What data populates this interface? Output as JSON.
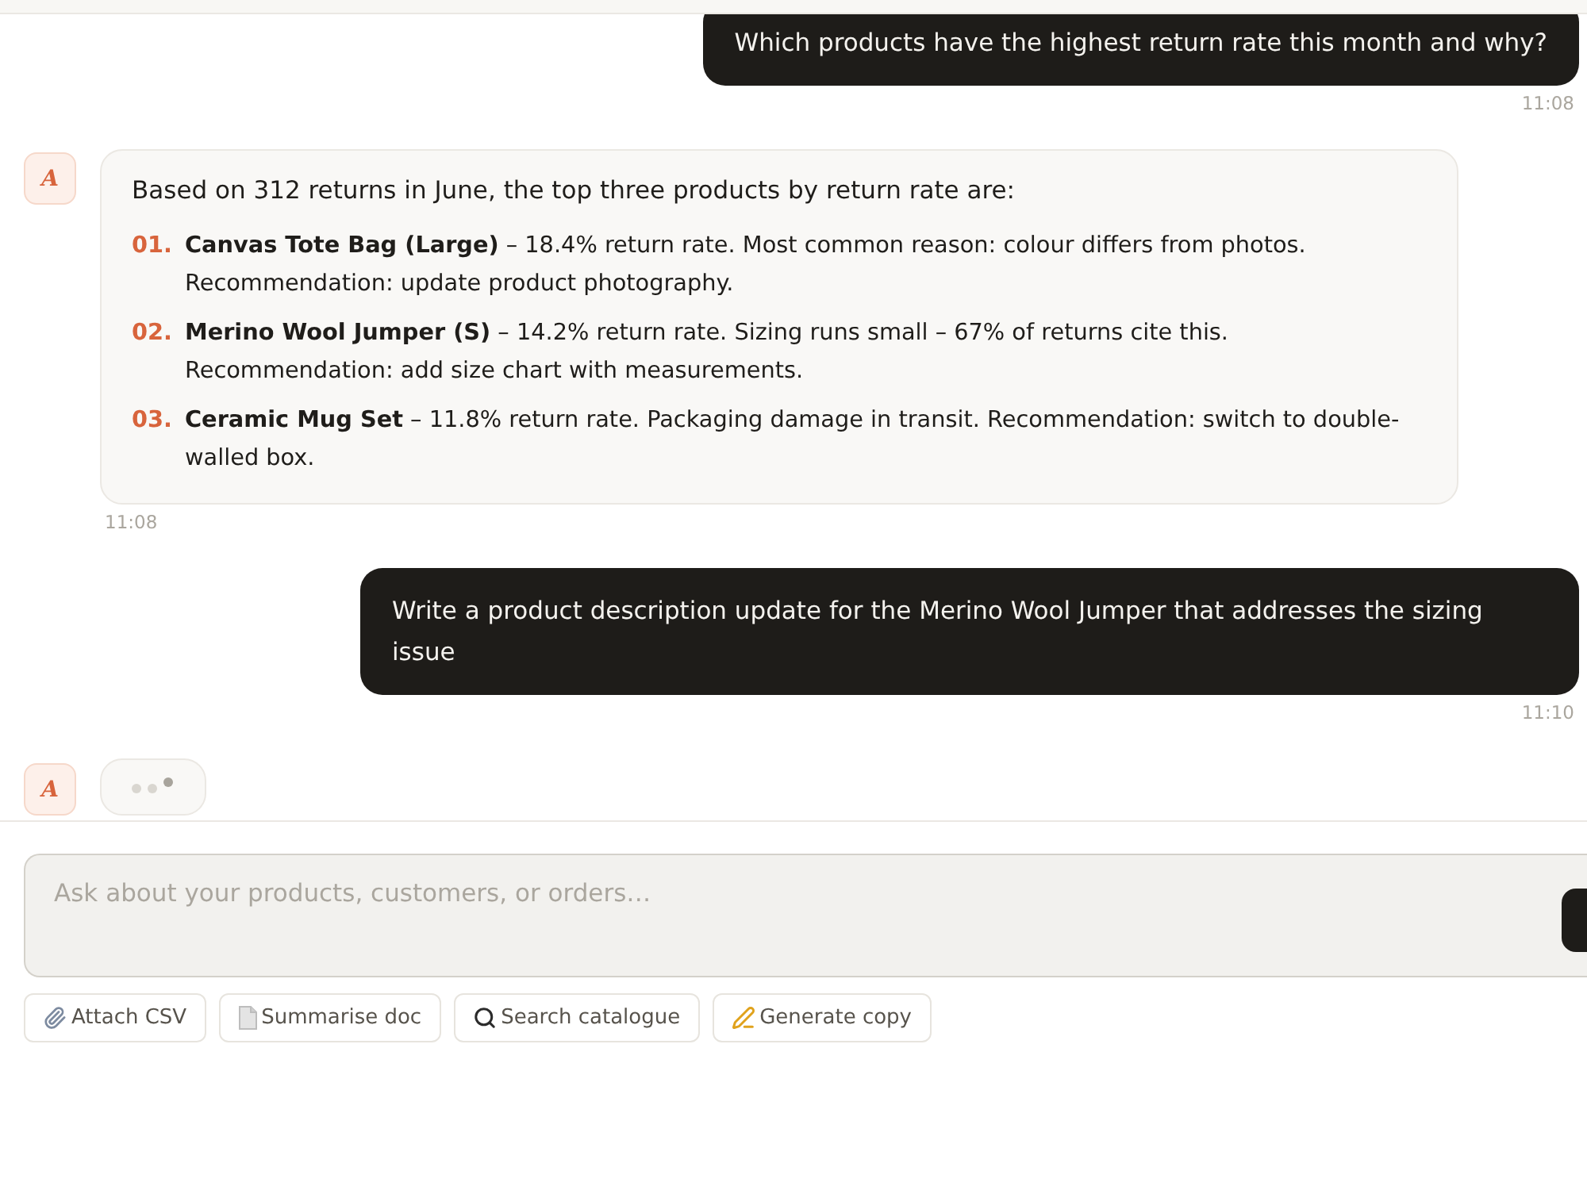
{
  "messages": [
    {
      "kind": "user",
      "text": "Which products have the highest return rate this month and why?",
      "time": "11:08"
    },
    {
      "kind": "assistant",
      "avatar": "A",
      "intro": "Based on 312 returns in June, the top three products by return rate are:",
      "items": [
        {
          "number": "01.",
          "text": "**Canvas Tote Bag (Large)** – 18.4% return rate. Most common reason: colour differs from photos. Recommendation: update product photography."
        },
        {
          "number": "02.",
          "text": "**Merino Wool Jumper (S)** – 14.2% return rate. Sizing runs small – 67% of returns cite this. Recommendation: add size chart with measurements."
        },
        {
          "number": "03.",
          "text": "**Ceramic Mug Set** – 11.8% return rate. Packaging damage in transit. Recommendation: switch to double-walled box."
        }
      ],
      "time": "11:08"
    },
    {
      "kind": "user",
      "text": "Write a product description update for the Merino Wool Jumper that addresses the sizing issue",
      "time": "11:10"
    },
    {
      "kind": "typing",
      "avatar": "A"
    }
  ],
  "composer": {
    "placeholder": "Ask about your products, customers, or orders…"
  },
  "quick_actions": [
    {
      "kind": "attach",
      "label": "Attach CSV"
    },
    {
      "kind": "summary",
      "label": "Summarise doc"
    },
    {
      "kind": "search",
      "label": "Search catalogue"
    },
    {
      "kind": "write",
      "label": "Generate copy"
    }
  ]
}
